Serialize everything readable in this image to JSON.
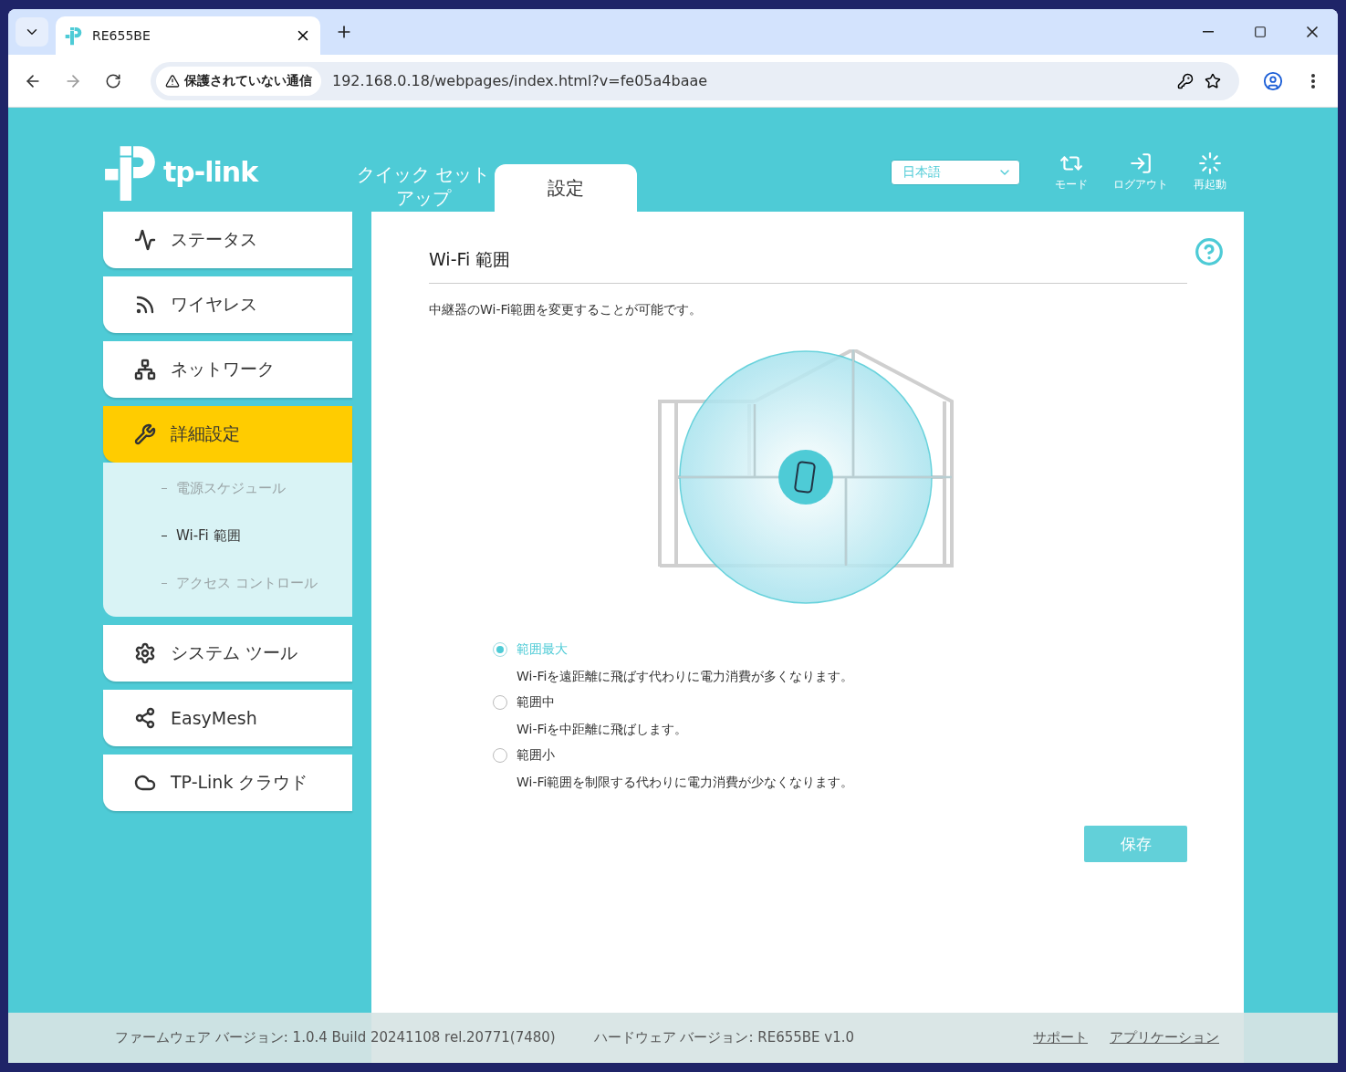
{
  "browser": {
    "tab_title": "RE655BE",
    "address_warning": "保護されていない通信",
    "url": "192.168.0.18/webpages/index.html?v=fe05a4baae"
  },
  "header": {
    "logo_text": "tp-link",
    "nav_tabs": [
      {
        "label": "クイック セットアップ",
        "selected": false
      },
      {
        "label": "設定",
        "selected": true
      }
    ],
    "language": "日本語",
    "actions": [
      {
        "label": "モード"
      },
      {
        "label": "ログアウト"
      },
      {
        "label": "再起動"
      }
    ]
  },
  "sidebar": {
    "items": [
      {
        "label": "ステータス",
        "selected": false
      },
      {
        "label": "ワイヤレス",
        "selected": false
      },
      {
        "label": "ネットワーク",
        "selected": false
      },
      {
        "label": "詳細設定",
        "selected": true,
        "expanded": true,
        "children": [
          {
            "label": "電源スケジュール",
            "selected": false
          },
          {
            "label": "Wi-Fi 範囲",
            "selected": true
          },
          {
            "label": "アクセス コントロール",
            "selected": false
          }
        ]
      },
      {
        "label": "システム ツール",
        "selected": false
      },
      {
        "label": "EasyMesh",
        "selected": false
      },
      {
        "label": "TP-Link クラウド",
        "selected": false
      }
    ]
  },
  "panel": {
    "title": "Wi-Fi 範囲",
    "description": "中継器のWi-Fi範囲を変更することが可能です。",
    "options": [
      {
        "label": "範囲最大",
        "description": "Wi-Fiを遠距離に飛ばす代わりに電力消費が多くなります。",
        "selected": true
      },
      {
        "label": "範囲中",
        "description": "Wi-Fiを中距離に飛ばします。",
        "selected": false
      },
      {
        "label": "範囲小",
        "description": "Wi-Fi範囲を制限する代わりに電力消費が少なくなります。",
        "selected": false
      }
    ],
    "save_button": "保存"
  },
  "footer": {
    "firmware": "ファームウェア バージョン: 1.0.4 Build 20241108 rel.20771(7480)",
    "hardware": "ハードウェア バージョン: RE655BE v1.0",
    "links": [
      "サポート",
      "アプリケーション"
    ]
  }
}
